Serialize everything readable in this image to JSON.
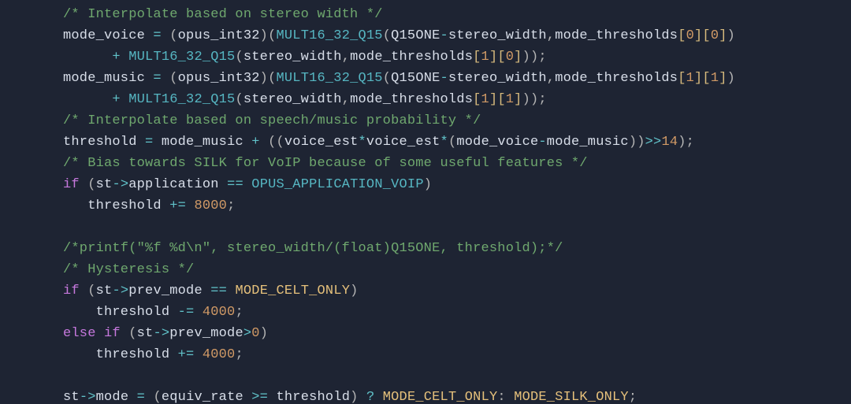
{
  "code": {
    "lines": [
      [
        {
          "c": "cm",
          "t": "/* Interpolate based on stereo width */"
        }
      ],
      [
        {
          "c": "id",
          "t": "mode_voice "
        },
        {
          "c": "op",
          "t": "="
        },
        {
          "c": "id",
          "t": " "
        },
        {
          "c": "pn",
          "t": "("
        },
        {
          "c": "id",
          "t": "opus_int32"
        },
        {
          "c": "pn",
          "t": ")("
        },
        {
          "c": "fn",
          "t": "MULT16_32_Q15"
        },
        {
          "c": "pn",
          "t": "("
        },
        {
          "c": "id",
          "t": "Q15ONE"
        },
        {
          "c": "op",
          "t": "-"
        },
        {
          "c": "id",
          "t": "stereo_width"
        },
        {
          "c": "pn",
          "t": ","
        },
        {
          "c": "id",
          "t": "mode_thresholds"
        },
        {
          "c": "br",
          "t": "["
        },
        {
          "c": "num",
          "t": "0"
        },
        {
          "c": "br",
          "t": "]["
        },
        {
          "c": "num",
          "t": "0"
        },
        {
          "c": "br",
          "t": "]"
        },
        {
          "c": "pn",
          "t": ")"
        }
      ],
      [
        {
          "c": "id",
          "t": "      "
        },
        {
          "c": "op",
          "t": "+"
        },
        {
          "c": "id",
          "t": " "
        },
        {
          "c": "fn",
          "t": "MULT16_32_Q15"
        },
        {
          "c": "pn",
          "t": "("
        },
        {
          "c": "id",
          "t": "stereo_width"
        },
        {
          "c": "pn",
          "t": ","
        },
        {
          "c": "id",
          "t": "mode_thresholds"
        },
        {
          "c": "br",
          "t": "["
        },
        {
          "c": "num",
          "t": "1"
        },
        {
          "c": "br",
          "t": "]["
        },
        {
          "c": "num",
          "t": "0"
        },
        {
          "c": "br",
          "t": "]"
        },
        {
          "c": "pn",
          "t": "));"
        }
      ],
      [
        {
          "c": "id",
          "t": "mode_music "
        },
        {
          "c": "op",
          "t": "="
        },
        {
          "c": "id",
          "t": " "
        },
        {
          "c": "pn",
          "t": "("
        },
        {
          "c": "id",
          "t": "opus_int32"
        },
        {
          "c": "pn",
          "t": ")("
        },
        {
          "c": "fn",
          "t": "MULT16_32_Q15"
        },
        {
          "c": "pn",
          "t": "("
        },
        {
          "c": "id",
          "t": "Q15ONE"
        },
        {
          "c": "op",
          "t": "-"
        },
        {
          "c": "id",
          "t": "stereo_width"
        },
        {
          "c": "pn",
          "t": ","
        },
        {
          "c": "id",
          "t": "mode_thresholds"
        },
        {
          "c": "br",
          "t": "["
        },
        {
          "c": "num",
          "t": "1"
        },
        {
          "c": "br",
          "t": "]["
        },
        {
          "c": "num",
          "t": "1"
        },
        {
          "c": "br",
          "t": "]"
        },
        {
          "c": "pn",
          "t": ")"
        }
      ],
      [
        {
          "c": "id",
          "t": "      "
        },
        {
          "c": "op",
          "t": "+"
        },
        {
          "c": "id",
          "t": " "
        },
        {
          "c": "fn",
          "t": "MULT16_32_Q15"
        },
        {
          "c": "pn",
          "t": "("
        },
        {
          "c": "id",
          "t": "stereo_width"
        },
        {
          "c": "pn",
          "t": ","
        },
        {
          "c": "id",
          "t": "mode_thresholds"
        },
        {
          "c": "br",
          "t": "["
        },
        {
          "c": "num",
          "t": "1"
        },
        {
          "c": "br",
          "t": "]["
        },
        {
          "c": "num",
          "t": "1"
        },
        {
          "c": "br",
          "t": "]"
        },
        {
          "c": "pn",
          "t": "));"
        }
      ],
      [
        {
          "c": "cm",
          "t": "/* Interpolate based on speech/music probability */"
        }
      ],
      [
        {
          "c": "id",
          "t": "threshold "
        },
        {
          "c": "op",
          "t": "="
        },
        {
          "c": "id",
          "t": " mode_music "
        },
        {
          "c": "op",
          "t": "+"
        },
        {
          "c": "id",
          "t": " "
        },
        {
          "c": "pn",
          "t": "(("
        },
        {
          "c": "id",
          "t": "voice_est"
        },
        {
          "c": "op",
          "t": "*"
        },
        {
          "c": "id",
          "t": "voice_est"
        },
        {
          "c": "op",
          "t": "*"
        },
        {
          "c": "pn",
          "t": "("
        },
        {
          "c": "id",
          "t": "mode_voice"
        },
        {
          "c": "op",
          "t": "-"
        },
        {
          "c": "id",
          "t": "mode_music"
        },
        {
          "c": "pn",
          "t": "))"
        },
        {
          "c": "op",
          "t": ">>"
        },
        {
          "c": "num",
          "t": "14"
        },
        {
          "c": "pn",
          "t": ");"
        }
      ],
      [
        {
          "c": "cm",
          "t": "/* Bias towards SILK for VoIP because of some useful features */"
        }
      ],
      [
        {
          "c": "kw",
          "t": "if"
        },
        {
          "c": "id",
          "t": " "
        },
        {
          "c": "pn",
          "t": "("
        },
        {
          "c": "id",
          "t": "st"
        },
        {
          "c": "op",
          "t": "->"
        },
        {
          "c": "id",
          "t": "application "
        },
        {
          "c": "op",
          "t": "=="
        },
        {
          "c": "id",
          "t": " "
        },
        {
          "c": "mac",
          "t": "OPUS_APPLICATION_VOIP"
        },
        {
          "c": "pn",
          "t": ")"
        }
      ],
      [
        {
          "c": "id",
          "t": "   threshold "
        },
        {
          "c": "op",
          "t": "+="
        },
        {
          "c": "id",
          "t": " "
        },
        {
          "c": "num",
          "t": "8000"
        },
        {
          "c": "pn",
          "t": ";"
        }
      ],
      [
        {
          "c": "id",
          "t": ""
        }
      ],
      [
        {
          "c": "cm",
          "t": "/*printf(\"%f %d\\n\", stereo_width/(float)Q15ONE, threshold);*/"
        }
      ],
      [
        {
          "c": "cm",
          "t": "/* Hysteresis */"
        }
      ],
      [
        {
          "c": "kw",
          "t": "if"
        },
        {
          "c": "id",
          "t": " "
        },
        {
          "c": "pn",
          "t": "("
        },
        {
          "c": "id",
          "t": "st"
        },
        {
          "c": "op",
          "t": "->"
        },
        {
          "c": "id",
          "t": "prev_mode "
        },
        {
          "c": "op",
          "t": "=="
        },
        {
          "c": "id",
          "t": " "
        },
        {
          "c": "mac2",
          "t": "MODE_CELT_ONLY"
        },
        {
          "c": "pn",
          "t": ")"
        }
      ],
      [
        {
          "c": "id",
          "t": "    threshold "
        },
        {
          "c": "op",
          "t": "-="
        },
        {
          "c": "id",
          "t": " "
        },
        {
          "c": "num",
          "t": "4000"
        },
        {
          "c": "pn",
          "t": ";"
        }
      ],
      [
        {
          "c": "kw",
          "t": "else if"
        },
        {
          "c": "id",
          "t": " "
        },
        {
          "c": "pn",
          "t": "("
        },
        {
          "c": "id",
          "t": "st"
        },
        {
          "c": "op",
          "t": "->"
        },
        {
          "c": "id",
          "t": "prev_mode"
        },
        {
          "c": "op",
          "t": ">"
        },
        {
          "c": "num",
          "t": "0"
        },
        {
          "c": "pn",
          "t": ")"
        }
      ],
      [
        {
          "c": "id",
          "t": "    threshold "
        },
        {
          "c": "op",
          "t": "+="
        },
        {
          "c": "id",
          "t": " "
        },
        {
          "c": "num",
          "t": "4000"
        },
        {
          "c": "pn",
          "t": ";"
        }
      ],
      [
        {
          "c": "id",
          "t": ""
        }
      ],
      [
        {
          "c": "id",
          "t": "st"
        },
        {
          "c": "op",
          "t": "->"
        },
        {
          "c": "id",
          "t": "mode "
        },
        {
          "c": "op",
          "t": "="
        },
        {
          "c": "id",
          "t": " "
        },
        {
          "c": "pn",
          "t": "("
        },
        {
          "c": "id",
          "t": "equiv_rate "
        },
        {
          "c": "op",
          "t": ">="
        },
        {
          "c": "id",
          "t": " threshold"
        },
        {
          "c": "pn",
          "t": ")"
        },
        {
          "c": "id",
          "t": " "
        },
        {
          "c": "op",
          "t": "?"
        },
        {
          "c": "id",
          "t": " "
        },
        {
          "c": "mac2",
          "t": "MODE_CELT_ONLY"
        },
        {
          "c": "pn",
          "t": ":"
        },
        {
          "c": "id",
          "t": " "
        },
        {
          "c": "mac2",
          "t": "MODE_SILK_ONLY"
        },
        {
          "c": "pn",
          "t": ";"
        }
      ]
    ]
  }
}
